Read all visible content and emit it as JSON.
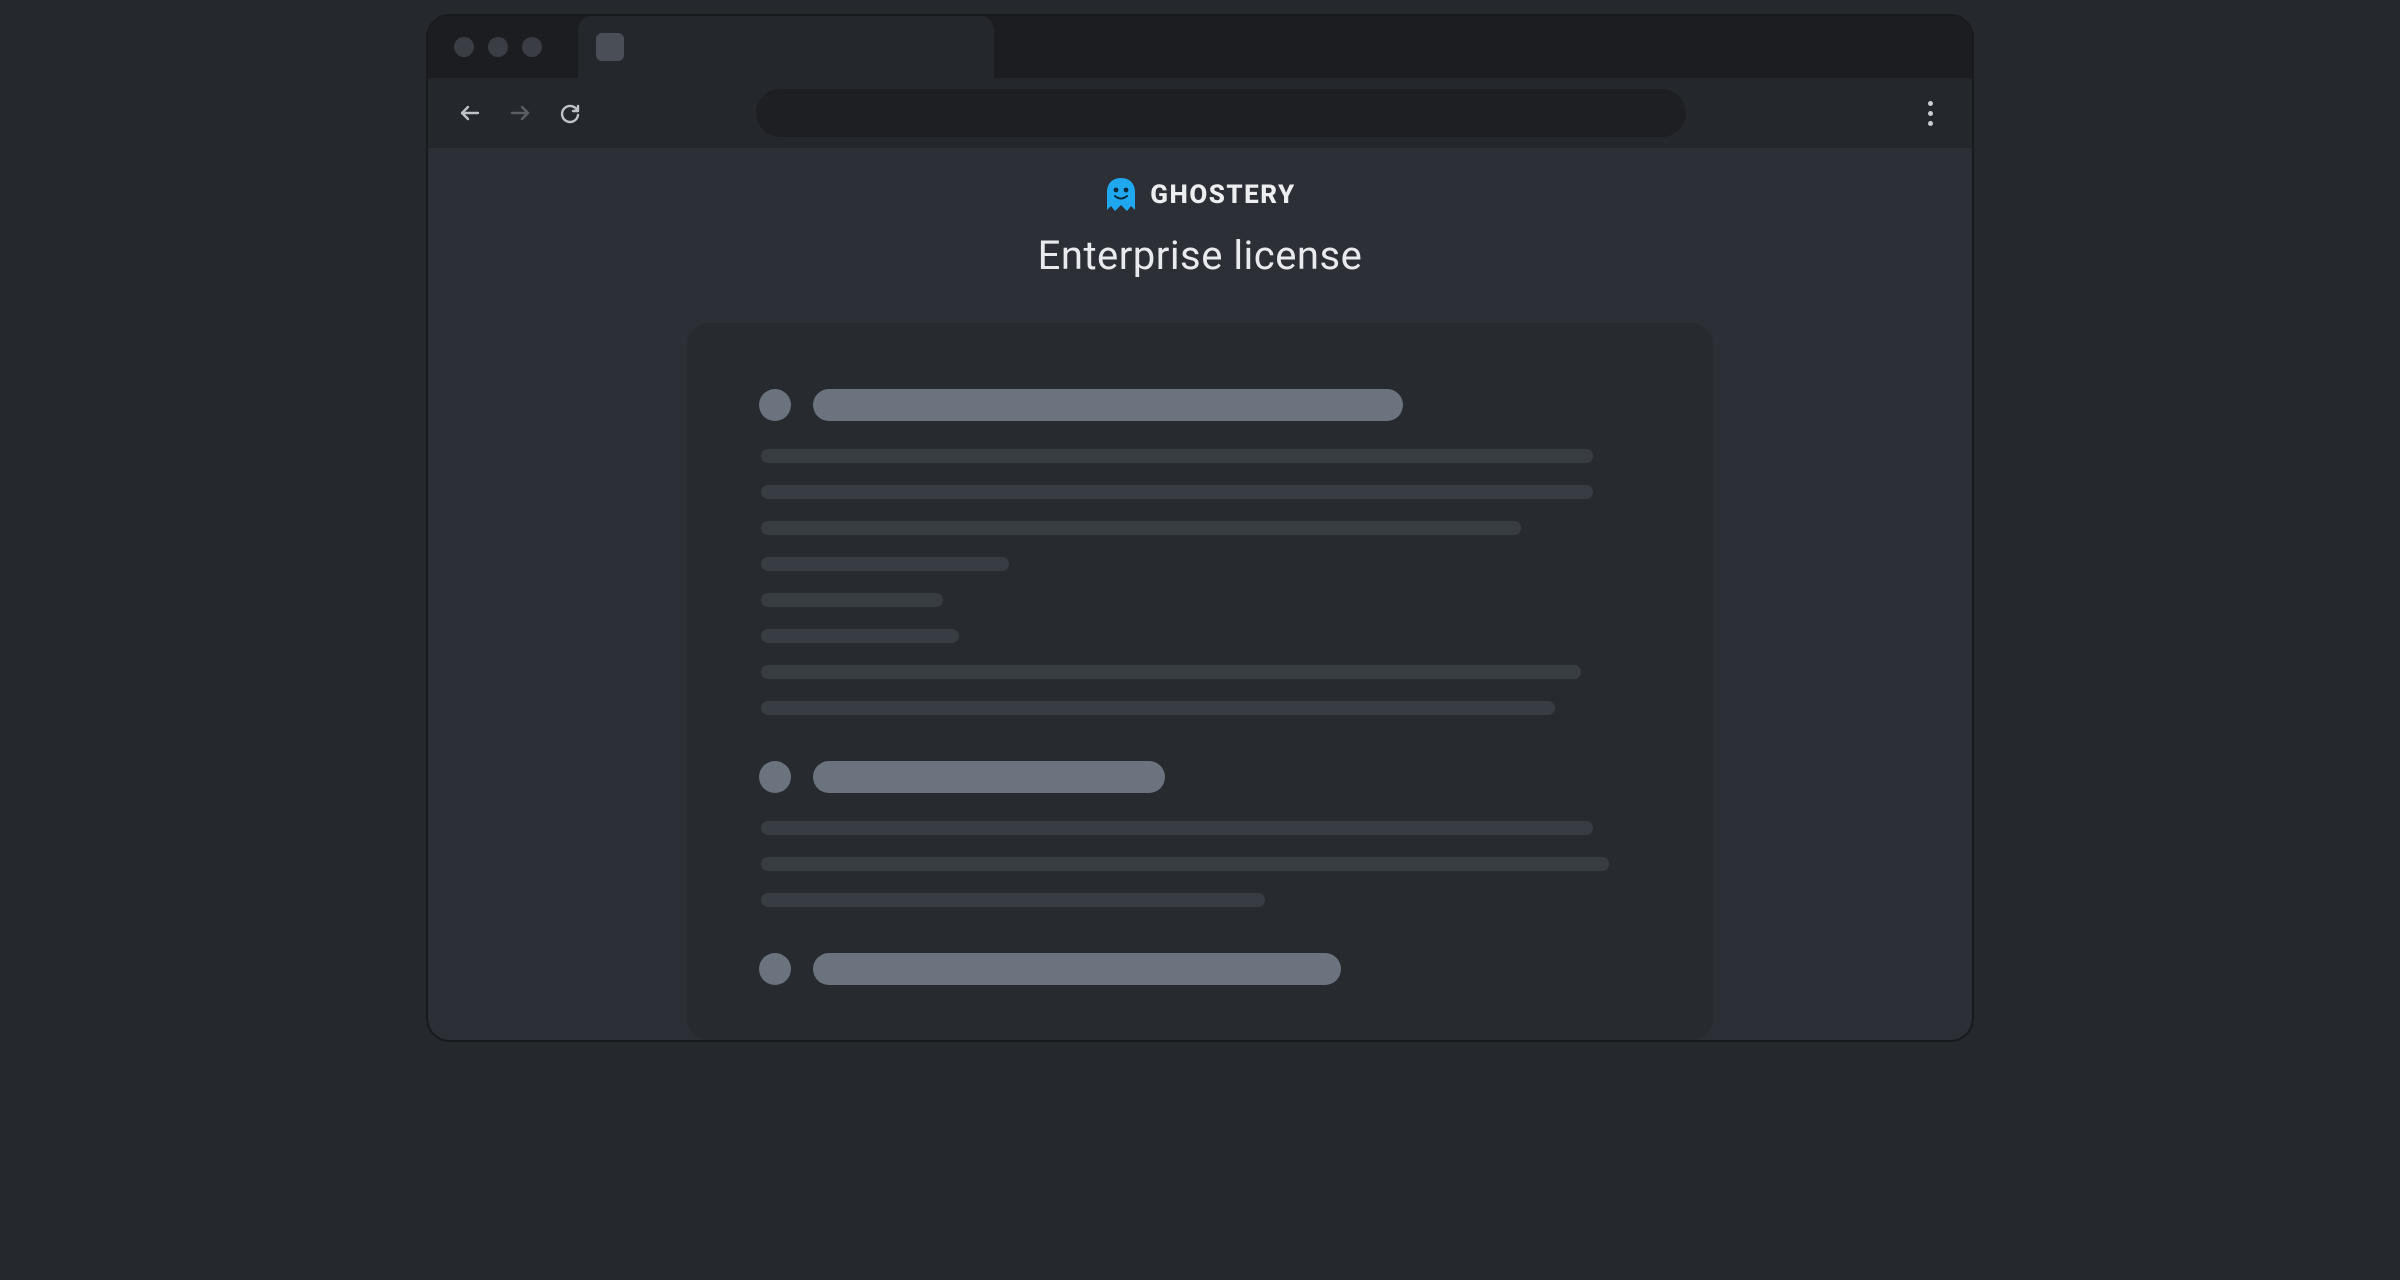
{
  "brand": {
    "name": "GHOSTERY"
  },
  "page": {
    "title": "Enterprise license"
  },
  "colors": {
    "pageBg": "#25282d",
    "windowBg": "#2c3036",
    "titlebarBg": "#1b1d20",
    "toolbarBg": "#24272c",
    "cardBg": "#272b30",
    "skeletonDark": "#383d44",
    "skeletonLight": "#6b737f",
    "ghostBlue": "#1fa8f0",
    "textLight": "#e8eaed"
  },
  "skeleton": {
    "sections": [
      {
        "headingWidth": 590,
        "lineWidths": [
          832,
          832,
          760,
          248,
          182,
          198,
          820,
          794
        ]
      },
      {
        "headingWidth": 352,
        "lineWidths": [
          832,
          848,
          504
        ]
      },
      {
        "headingWidth": 528,
        "lineWidths": []
      }
    ]
  }
}
